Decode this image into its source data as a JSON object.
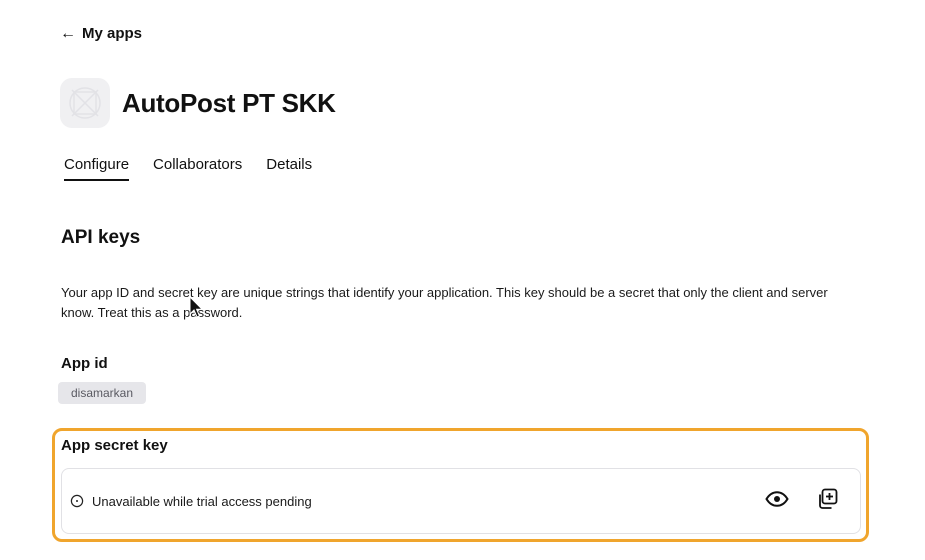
{
  "nav": {
    "back_label": "My apps",
    "back_icon": "arrow-left-icon"
  },
  "app": {
    "name": "AutoPost PT SKK",
    "icon": "app-placeholder-icon"
  },
  "tabs": [
    {
      "label": "Configure",
      "active": true
    },
    {
      "label": "Collaborators",
      "active": false
    },
    {
      "label": "Details",
      "active": false
    }
  ],
  "api_keys": {
    "title": "API keys",
    "description": "Your app ID and secret key are unique strings that identify your application. This key should be a secret that only the client and server know. Treat this as a password.",
    "app_id": {
      "label": "App id",
      "value": "disamarkan"
    },
    "secret": {
      "label": "App secret key",
      "status_text": "Unavailable while trial access pending",
      "status_icon": "clock-icon",
      "reveal_icon": "eye-icon",
      "copy_icon": "copy-icon"
    }
  },
  "colors": {
    "highlight": "#f0a52d",
    "chip_bg": "#e6e6ea",
    "text": "#111111"
  }
}
